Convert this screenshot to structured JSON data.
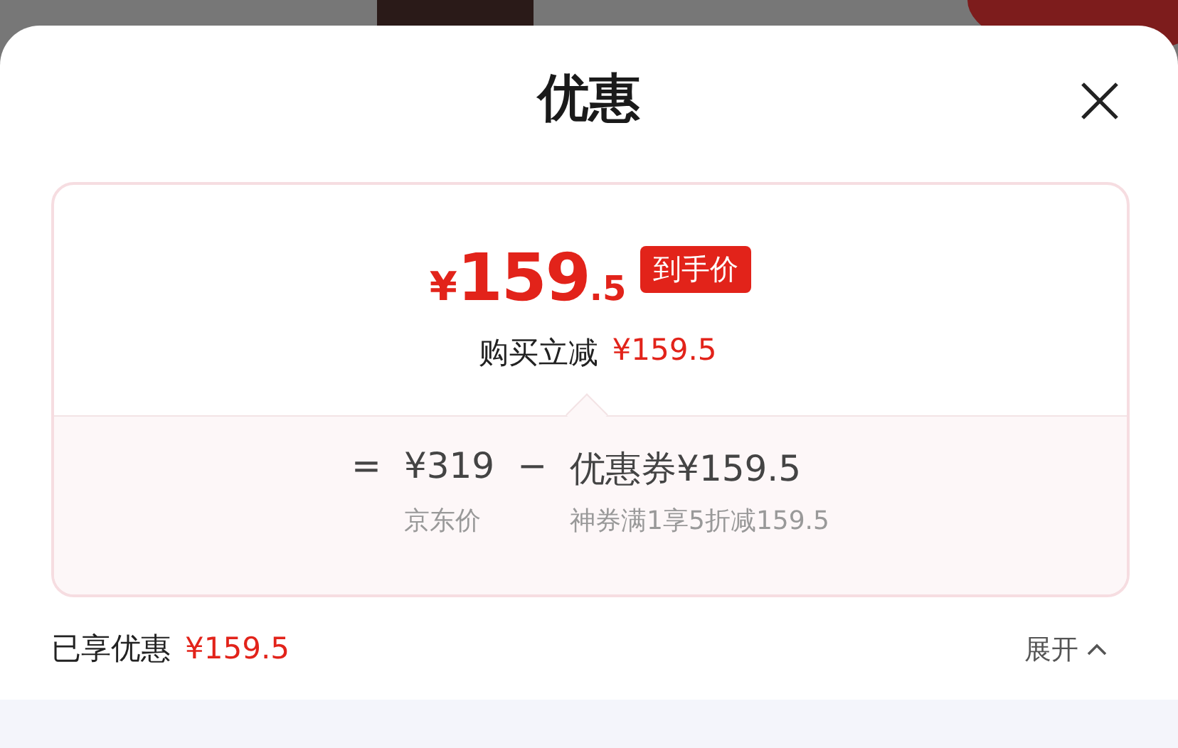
{
  "title": "优惠",
  "price": {
    "currency": "¥",
    "integer": "159",
    "decimal": ".5",
    "badge": "到手价"
  },
  "instant_discount": {
    "label": "购买立减",
    "amount": "¥159.5"
  },
  "formula": {
    "equals": "=",
    "base_price": "¥319",
    "base_label": "京东价",
    "minus": "−",
    "coupon_amount": "优惠券¥159.5",
    "coupon_label": "神券满1享5折减159.5"
  },
  "footer": {
    "label": "已享优惠",
    "amount": "¥159.5",
    "toggle": "展开"
  }
}
